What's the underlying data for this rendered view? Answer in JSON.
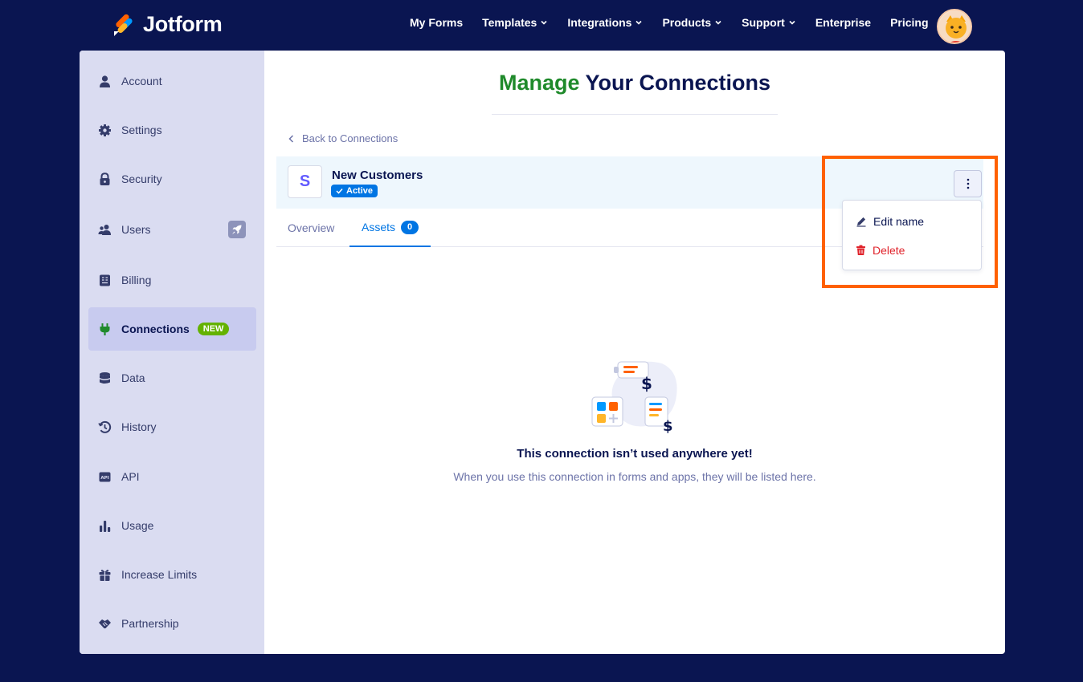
{
  "brand": {
    "name": "Jotform"
  },
  "nav": {
    "items": [
      {
        "label": "My Forms",
        "dropdown": false
      },
      {
        "label": "Templates",
        "dropdown": true
      },
      {
        "label": "Integrations",
        "dropdown": true
      },
      {
        "label": "Products",
        "dropdown": true
      },
      {
        "label": "Support",
        "dropdown": true
      },
      {
        "label": "Enterprise",
        "dropdown": false
      },
      {
        "label": "Pricing",
        "dropdown": false
      }
    ]
  },
  "sidebar": {
    "items": [
      {
        "label": "Account",
        "icon": "user-icon"
      },
      {
        "label": "Settings",
        "icon": "gear-icon"
      },
      {
        "label": "Security",
        "icon": "lock-icon"
      },
      {
        "label": "Users",
        "icon": "users-icon"
      },
      {
        "label": "Billing",
        "icon": "billing-icon"
      },
      {
        "label": "Connections",
        "icon": "plug-icon",
        "badge": "NEW",
        "active": true
      },
      {
        "label": "Data",
        "icon": "database-icon"
      },
      {
        "label": "History",
        "icon": "history-icon"
      },
      {
        "label": "API",
        "icon": "api-icon"
      },
      {
        "label": "Usage",
        "icon": "bar-chart-icon"
      },
      {
        "label": "Increase Limits",
        "icon": "gift-icon"
      },
      {
        "label": "Partnership",
        "icon": "handshake-icon"
      }
    ]
  },
  "page": {
    "title_highlight": "Manage",
    "title_rest": " Your Connections",
    "back_label": "Back to Connections"
  },
  "connection": {
    "logo_letter": "S",
    "name": "New Customers",
    "status": "Active"
  },
  "tabs": [
    {
      "label": "Overview",
      "selected": false
    },
    {
      "label": "Assets",
      "selected": true,
      "count": "0"
    }
  ],
  "menu": {
    "edit_label": "Edit name",
    "delete_label": "Delete"
  },
  "empty_state": {
    "title": "This connection isn’t used anywhere yet!",
    "subtitle": "When you use this connection in forms and apps, they will be listed here."
  },
  "colors": {
    "background": "#0a1551",
    "accent": "#0075e3",
    "highlight": "#ff6100",
    "brand_green": "#1f8a2b",
    "danger": "#e0232b"
  }
}
